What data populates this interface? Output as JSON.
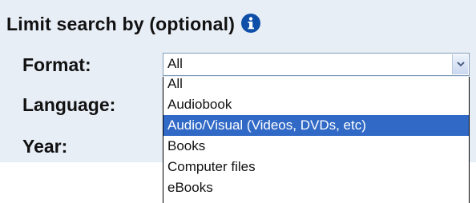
{
  "section": {
    "title": "Limit search by (optional)",
    "info_icon": "info-icon"
  },
  "fields": {
    "format_label": "Format:",
    "language_label": "Language:",
    "year_label": "Year:"
  },
  "format_select": {
    "selected_value": "All",
    "arrow_icon": "chevron-down-icon",
    "options": [
      "All",
      "Audiobook",
      "Audio/Visual (Videos, DVDs, etc)",
      "Books",
      "Computer files",
      "eBooks"
    ],
    "highlighted_option": "Audio/Visual (Videos, DVDs, etc)"
  },
  "colors": {
    "panel_background": "#e8eef6",
    "highlight": "#3169c6",
    "info_icon": "#0f4fa8"
  }
}
